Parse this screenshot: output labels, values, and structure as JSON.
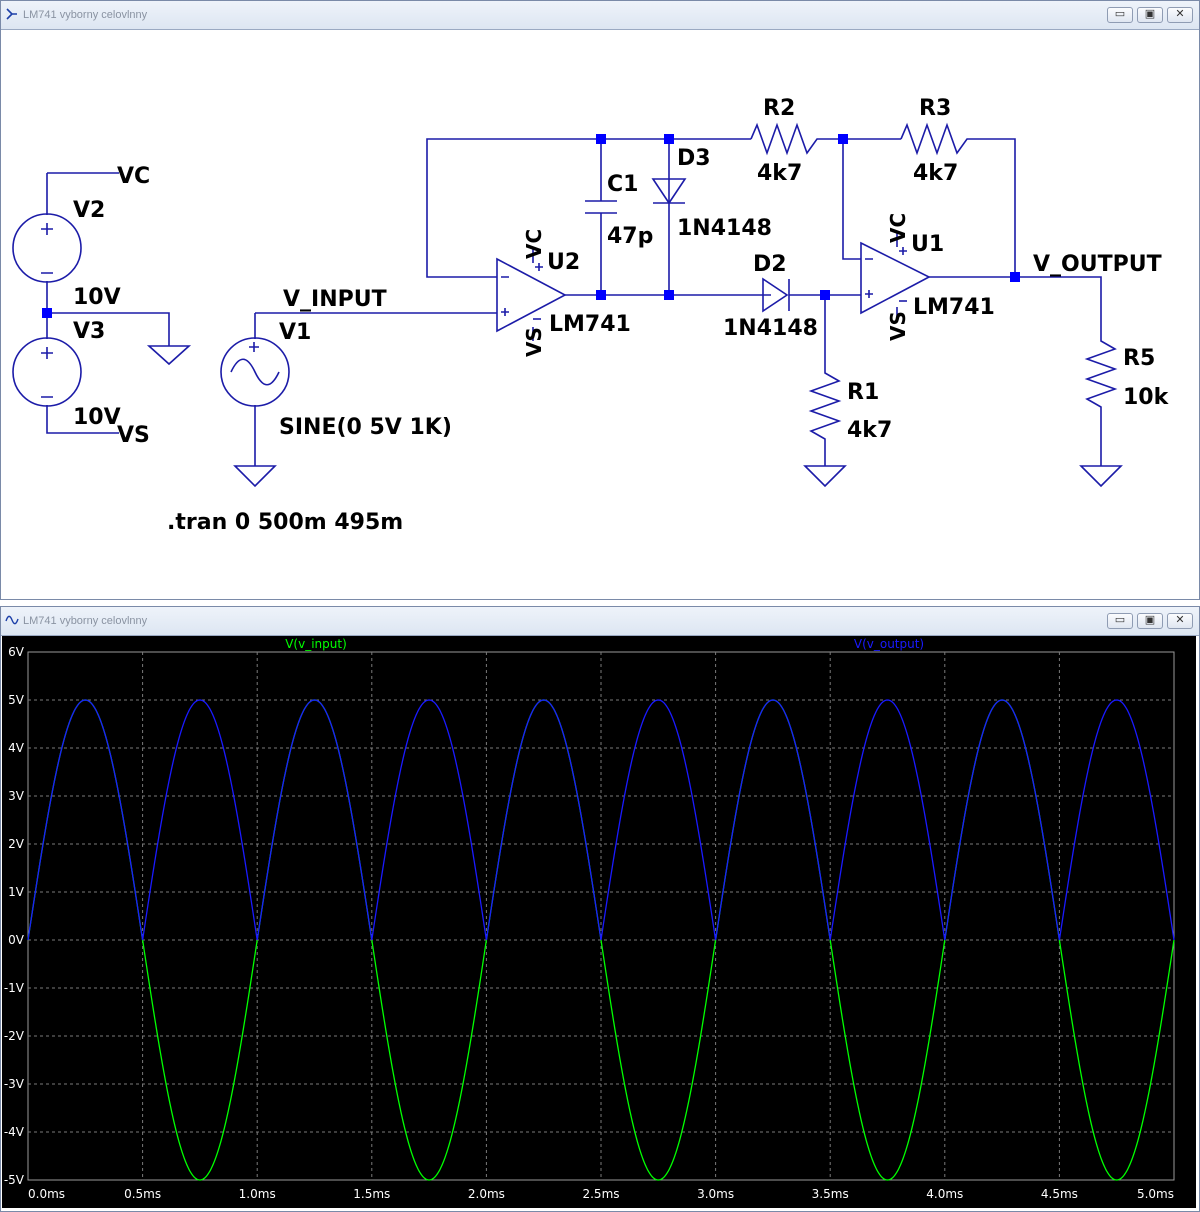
{
  "schematic_window": {
    "title": "LM741 vyborny celovlnny",
    "buttons": [
      "▭",
      "▣",
      "✕"
    ]
  },
  "schematic": {
    "labels": {
      "vc_supply": "VC",
      "vs_supply": "VS",
      "v2": "V2",
      "v3": "V3",
      "v2_value": "10V",
      "v3_value": "10V",
      "v1": "V1",
      "v1_value": "SINE(0 5V 1K)",
      "net_input": "V_INPUT",
      "net_output": "V_OUTPUT",
      "c1": "C1",
      "c1_value": "47p",
      "d3": "D3",
      "d3_value": "1N4148",
      "d2": "D2",
      "d2_value": "1N4148",
      "r1": "R1",
      "r1_value": "4k7",
      "r2": "R2",
      "r2_value": "4k7",
      "r3": "R3",
      "r3_value": "4k7",
      "r5": "R5",
      "r5_value": "10k",
      "u2": "U2",
      "u2_value": "LM741",
      "u1": "U1",
      "u1_value": "LM741",
      "u2_vc": "VC",
      "u2_vs": "VS",
      "u1_vc": "VC",
      "u1_vs": "VS",
      "tran": ".tran 0 500m 495m"
    },
    "colors": {
      "wire": "#1c1ca8",
      "text": "#000000",
      "junction": "#0000ff"
    }
  },
  "waveform_window": {
    "title": "LM741 vyborny celovlnny",
    "buttons": [
      "▭",
      "▣",
      "✕"
    ]
  },
  "chart_data": {
    "type": "line",
    "title": "",
    "xlabel": "",
    "ylabel": "",
    "x_unit": "ms",
    "xlim": [
      0,
      5
    ],
    "ylim": [
      -5,
      6
    ],
    "x_ticks": [
      "0.0ms",
      "0.5ms",
      "1.0ms",
      "1.5ms",
      "2.0ms",
      "2.5ms",
      "3.0ms",
      "3.5ms",
      "4.0ms",
      "4.5ms",
      "5.0ms"
    ],
    "x_tick_values": [
      0,
      0.5,
      1,
      1.5,
      2,
      2.5,
      3,
      3.5,
      4,
      4.5,
      5
    ],
    "y_ticks": [
      "6V",
      "5V",
      "4V",
      "3V",
      "2V",
      "1V",
      "0V",
      "-1V",
      "-2V",
      "-3V",
      "-4V",
      "-5V"
    ],
    "y_tick_values": [
      6,
      5,
      4,
      3,
      2,
      1,
      0,
      -1,
      -2,
      -3,
      -4,
      -5
    ],
    "grid": true,
    "legend": "top",
    "background": "#000000",
    "series": [
      {
        "name": "V(v_input)",
        "color": "#00ff00",
        "expr": "5*sin(2*pi*1kHz*t)",
        "amplitude": 5,
        "frequency_khz": 1
      },
      {
        "name": "V(v_output)",
        "color": "#1a1aff",
        "expr": "|5*sin(2*pi*1kHz*t)|",
        "amplitude": 5,
        "frequency_khz": 1
      }
    ]
  }
}
